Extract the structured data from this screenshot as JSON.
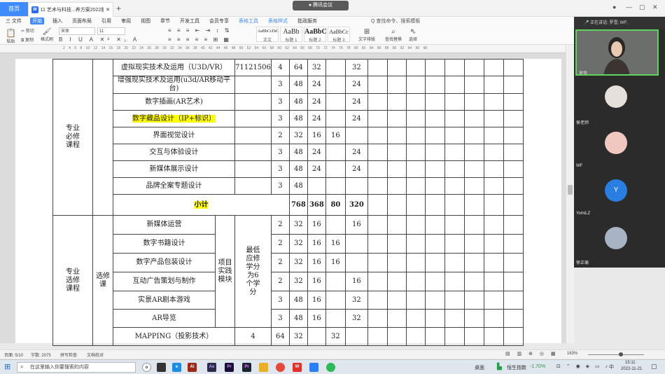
{
  "titlebar": {
    "home": "首页",
    "doc_tab": "11 艺术与科技...养方案2022版",
    "meeting": "腾讯会议",
    "wicon": "W"
  },
  "menu": {
    "file": "三 文件",
    "items": [
      "开始",
      "插入",
      "页面布局",
      "引用",
      "审阅",
      "视图",
      "章节",
      "开发工具",
      "会员专享",
      "表格工具",
      "表格样式",
      "批政服务"
    ],
    "search": "Q 查找命令、搜索模板"
  },
  "ribbon": {
    "clip": [
      "粘贴",
      "剪切",
      "复制",
      "格式刷"
    ],
    "font": "宋体",
    "size": "11",
    "styles": [
      {
        "sample": "AaBbCcDd",
        "name": "正文"
      },
      {
        "sample": "AaBb",
        "name": "标题 1"
      },
      {
        "sample": "AaBbC",
        "name": "标题 2"
      },
      {
        "sample": "AaBbCc",
        "name": "标题 3"
      }
    ],
    "text_layout": "文字排版",
    "find_replace": "查找替换",
    "select": "选择"
  },
  "ruler": "2 4 6 8 10 12 14 16 18 20 22 24 26 28 30 32 34 36 38 40 42 44 46 48 50 52 54 56 58 60 62 64 66 68 70 72 74 76 78 80 82 84 86 88 90 92 94 96 98",
  "table": {
    "group1": "专业必修课程",
    "rows1": [
      {
        "name": "虚拟现实技术及运用（U3D/VR）",
        "code": "71121506",
        "c": "4",
        "h": "64",
        "a": "32",
        "b": "",
        "d": "32"
      },
      {
        "name": "增强现实技术及运用(u3d/AR移动平台)",
        "c": "3",
        "h": "48",
        "a": "24",
        "b": "",
        "d": "24"
      },
      {
        "name": "数字插画(AR艺术)",
        "c": "3",
        "h": "48",
        "a": "24",
        "b": "",
        "d": "24"
      },
      {
        "name": "数字藏品设计（IP+标识）",
        "c": "3",
        "h": "48",
        "a": "24",
        "b": "",
        "d": "24"
      },
      {
        "name": "界面视觉设计",
        "c": "2",
        "h": "32",
        "a": "16",
        "b": "16",
        "d": ""
      },
      {
        "name": "交互与体验设计",
        "c": "3",
        "h": "48",
        "a": "24",
        "b": "",
        "d": "24"
      },
      {
        "name": "新媒体展示设计",
        "c": "3",
        "h": "48",
        "a": "24",
        "b": "",
        "d": "24"
      },
      {
        "name": "品牌全案专题设计",
        "c": "3",
        "h": "48",
        "a": "",
        "b": "",
        "d": ""
      }
    ],
    "subtotal": {
      "label": "小计",
      "h": "768",
      "a": "368",
      "b": "80",
      "d": "320"
    },
    "group2": "专业选修课程",
    "sub2": "选修课",
    "type2": "项目实践模块",
    "note2": "最低应修学分为6个学分",
    "rows2": [
      {
        "name": "新媒体运营",
        "c": "2",
        "h": "32",
        "a": "16",
        "b": "",
        "d": "16"
      },
      {
        "name": "数字书籍设计",
        "c": "2",
        "h": "32",
        "a": "16",
        "b": "16",
        "d": ""
      },
      {
        "name": "数字产品包装设计",
        "c": "2",
        "h": "32",
        "a": "16",
        "b": "16",
        "d": ""
      },
      {
        "name": "互动广告策划与制作",
        "c": "2",
        "h": "32",
        "a": "16",
        "b": "",
        "d": "16"
      },
      {
        "name": "实景AR剧本游戏",
        "c": "3",
        "h": "48",
        "a": "16",
        "b": "",
        "d": "32"
      },
      {
        "name": "AR导览",
        "c": "3",
        "h": "48",
        "a": "16",
        "b": "",
        "d": "32"
      }
    ],
    "last": {
      "name": "MAPPING（投影技术）",
      "credit": "4",
      "hours": "64",
      "a": "32",
      "d": "32"
    }
  },
  "status": {
    "page": "页面: 5/10",
    "words": "字数: 2075",
    "spell": "拼写检查",
    "proof": "文档校对",
    "zoom": "163%"
  },
  "taskbar": {
    "search": "在这里输入你要搜索的内容",
    "desk": "桌面",
    "stock": "恒生指数",
    "change": "-1.70%",
    "time": "15:11",
    "date": "2022-11-21",
    "lang": "中"
  },
  "side": {
    "speaking": "正在讲话: 罗雪; WF;",
    "users": [
      "罗雪",
      "侯老师",
      "WF",
      "YomiLZ",
      "徐正瑜"
    ],
    "y_initial": "Y"
  },
  "colors": {
    "accent": "#3d8bff",
    "highlight": "#ffff00",
    "side_bg": "#2b2b2b"
  }
}
